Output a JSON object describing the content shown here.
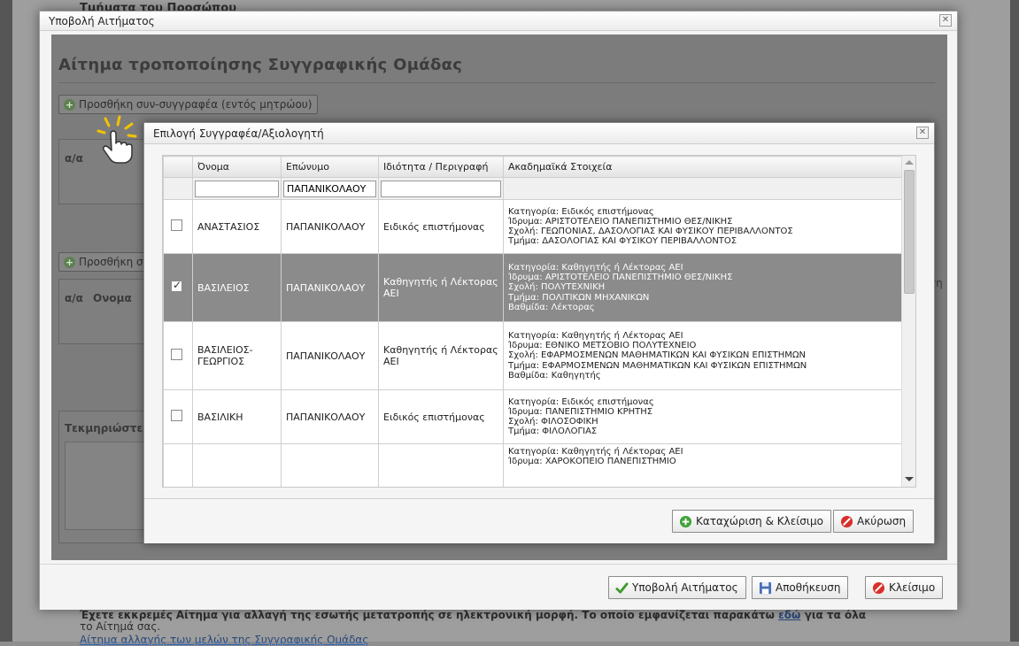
{
  "background": {
    "title": "Τμήματα του Προσώπου",
    "line1": "Έχετε εκκρεμές Αίτημα για αλλαγή της εσωτής μετατροπής σε ηλεκτρονική μορφή. Το οποίο εμφανίζεται παρακάτω",
    "line1_link": "εδώ",
    "line1_end": "για τα όλα",
    "line2": "το Αίτημά σας.",
    "line3": "Αίτημα αλλαγής των μελών της Συγγραφικής Ομάδας"
  },
  "outer": {
    "title": "Υποβολή Αιτήματος",
    "heading": "Αίτημα τροποποίησης Συγγραφικής Ομάδας",
    "add_internal": "Προσθήκη συν-συγγραφέα (εντός μητρώου)",
    "add_other": "Προσθήκη σ",
    "table1_col1": "α/α",
    "table2_col1": "α/α",
    "table2_col2": "Ονομα",
    "justify_label": "Τεκμηριώστε",
    "right_cut": "εση",
    "buttons": {
      "submit": "Υποβολή Αιτήματος",
      "save": "Αποθήκευση",
      "close": "Κλείσιμο"
    }
  },
  "inner": {
    "title": "Επιλογή Συγγραφέα/Αξιολογητή",
    "columns": [
      "Όνομα",
      "Επώνυμο",
      "Ιδιότητα / Περιγραφή",
      "Ακαδημαϊκά Στοιχεία"
    ],
    "filters": {
      "first_name": "",
      "last_name": "ΠΑΠΑΝΙΚΟΛΑΟΥ",
      "description": ""
    },
    "rows": [
      {
        "checked": false,
        "first_name": "ΑΝΑΣΤΑΣΙΟΣ",
        "last_name": "ΠΑΠΑΝΙΚΟΛΑΟΥ",
        "description": "Ειδικός επιστήμονας",
        "details": [
          "Κατηγορία: Ειδικός επιστήμονας",
          "Ίδρυμα: ΑΡΙΣΤΟΤΕΛΕΙΟ ΠΑΝΕΠΙΣΤΗΜΙΟ ΘΕΣ/ΝΙΚΗΣ",
          "Σχολή: ΓΕΩΠΟΝΙΑΣ, ΔΑΣΟΛΟΓΙΑΣ ΚΑΙ ΦΥΣΙΚΟΥ ΠΕΡΙΒΑΛΛΟΝΤΟΣ",
          "Τμήμα: ΔΑΣΟΛΟΓΙΑΣ ΚΑΙ ΦΥΣΙΚΟΥ ΠΕΡΙΒΑΛΛΟΝΤΟΣ"
        ]
      },
      {
        "checked": true,
        "first_name": "ΒΑΣΙΛΕΙΟΣ",
        "last_name": "ΠΑΠΑΝΙΚΟΛΑΟΥ",
        "description": "Καθηγητής ή Λέκτορας ΑΕΙ",
        "details": [
          "Κατηγορία: Καθηγητής ή Λέκτορας ΑΕΙ",
          "Ίδρυμα: ΑΡΙΣΤΟΤΕΛΕΙΟ ΠΑΝΕΠΙΣΤΗΜΙΟ ΘΕΣ/ΝΙΚΗΣ",
          "Σχολή: ΠΟΛΥΤΕΧΝΙΚΗ",
          "Τμήμα: ΠΟΛΙΤΙΚΩΝ ΜΗΧΑΝΙΚΩΝ",
          "Βαθμίδα: Λέκτορας"
        ]
      },
      {
        "checked": false,
        "first_name": "ΒΑΣΙΛΕΙΟΣ-ΓΕΩΡΓΙΟΣ",
        "last_name": "ΠΑΠΑΝΙΚΟΛΑΟΥ",
        "description": "Καθηγητής ή Λέκτορας ΑΕΙ",
        "details": [
          "Κατηγορία: Καθηγητής ή Λέκτορας ΑΕΙ",
          "Ίδρυμα: ΕΘΝΙΚΟ ΜΕΤΣΟΒΙΟ ΠΟΛΥΤΕΧΝΕΙΟ",
          "Σχολή: ΕΦΑΡΜΟΣΜΕΝΩΝ ΜΑΘΗΜΑΤΙΚΩΝ ΚΑΙ ΦΥΣΙΚΩΝ ΕΠΙΣΤΗΜΩΝ",
          "Τμήμα: ΕΦΑΡΜΟΣΜΕΝΩΝ ΜΑΘΗΜΑΤΙΚΩΝ ΚΑΙ ΦΥΣΙΚΩΝ ΕΠΙΣΤΗΜΩΝ",
          "Βαθμίδα: Καθηγητής"
        ]
      },
      {
        "checked": false,
        "first_name": "ΒΑΣΙΛΙΚΗ",
        "last_name": "ΠΑΠΑΝΙΚΟΛΑΟΥ",
        "description": "Ειδικός επιστήμονας",
        "details": [
          "Κατηγορία: Ειδικός επιστήμονας",
          "Ίδρυμα: ΠΑΝΕΠΙΣΤΗΜΙΟ ΚΡΗΤΗΣ",
          "Σχολή: ΦΙΛΟΣΟΦΙΚΗ",
          "Τμήμα: ΦΙΛΟΛΟΓΙΑΣ"
        ]
      },
      {
        "checked": false,
        "first_name": "",
        "last_name": "",
        "description": "",
        "details": [
          "Κατηγορία: Καθηγητής ή Λέκτορας ΑΕΙ",
          "Ίδρυμα: ΧΑΡΟΚΟΠΕΙΟ ΠΑΝΕΠΙΣΤΗΜΙΟ"
        ]
      }
    ],
    "buttons": {
      "save_close": "Καταχώριση & Κλείσιμο",
      "cancel": "Ακύρωση"
    }
  },
  "colors": {
    "selected_row": "#8b8b8b",
    "add_icon": "#3fa23a",
    "cancel_icon": "#d9302b"
  }
}
